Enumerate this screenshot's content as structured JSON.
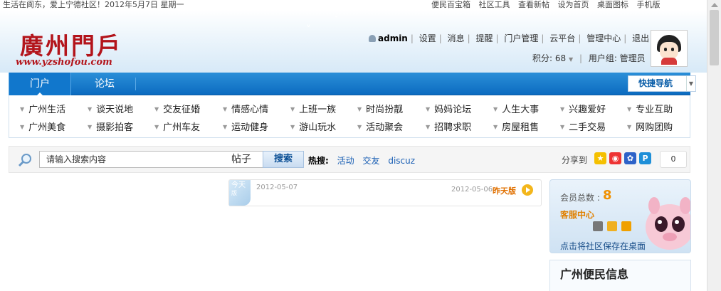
{
  "topbar": {
    "welcome": "生活在阆东，爱上宁德社区！2012年5月7日  星期一",
    "links": [
      "便民百宝箱",
      "社区工具",
      "查看新帖",
      "设为首页",
      "桌面图标",
      "手机版"
    ]
  },
  "logo": {
    "cn": "廣州門戶",
    "en": "www.yzshofou.com"
  },
  "user": {
    "name": "admin",
    "menu": [
      "设置",
      "消息",
      "提醒",
      "门户管理",
      "云平台",
      "管理中心",
      "退出"
    ],
    "points_label": "积分: 68",
    "group_label": "用户组: 管理员"
  },
  "nav": {
    "tabs": [
      "门户",
      "论坛"
    ],
    "quick_nav": "快捷导航"
  },
  "categories": [
    [
      "广州生活",
      "谈天说地",
      "交友征婚",
      "情感心情",
      "上班一族",
      "时尚扮靓",
      "妈妈论坛",
      "人生大事",
      "兴趣爱好",
      "专业互助"
    ],
    [
      "广州美食",
      "摄影拍客",
      "广州车友",
      "运动健身",
      "游山玩水",
      "活动聚会",
      "招聘求职",
      "房屋租售",
      "二手交易",
      "网购团购"
    ]
  ],
  "search": {
    "placeholder": "请输入搜索内容",
    "type": "帖子",
    "button": "搜索",
    "hot_label": "热搜:",
    "hot": [
      "活动",
      "交友",
      "discuz"
    ]
  },
  "share": {
    "label": "分享到",
    "count": "0"
  },
  "newspaper": {
    "badge_top": "今天",
    "badge_bottom": "版",
    "today_date": "2012-05-07",
    "yesterday_date": "2012-05-06",
    "yesterday_label": "昨天版"
  },
  "member": {
    "total_label": "会员总数 :",
    "total": "8",
    "service": "客服中心",
    "save_desktop": "点击将社区保存在桌面"
  },
  "info": {
    "title": "广州便民信息"
  },
  "colors": {
    "nav_blue": "#0b6bc0",
    "logo_red": "#b3141b",
    "accent_orange": "#f09000"
  }
}
